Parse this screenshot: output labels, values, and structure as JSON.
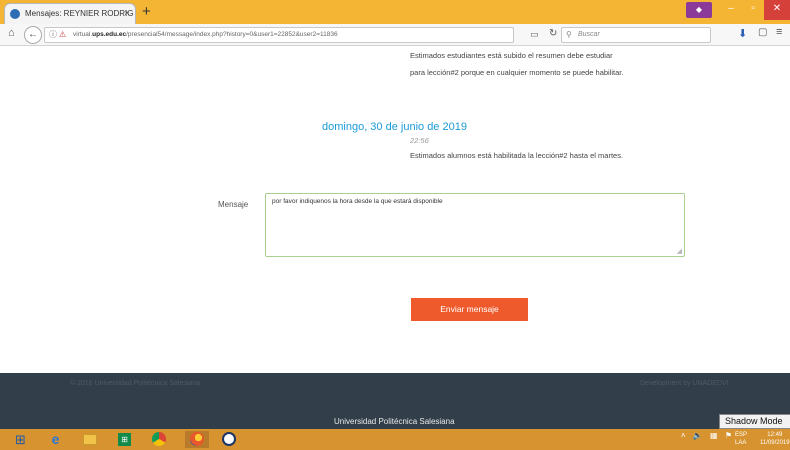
{
  "browser": {
    "tab_title": "Mensajes: REYNIER RODRIG",
    "tab_close": "×",
    "new_tab": "+",
    "url_prefix": "virtual.",
    "url_domain": "ups.edu.ec",
    "url_path": "/presencial54/message/index.php?history=0&user1=22852&user2=11836",
    "search_placeholder": "Buscar"
  },
  "messages": [
    {
      "text": "Estimados estudiantes está subido el resumen debe estudiar"
    },
    {
      "text": "para lección#2 porque en cualquier momento se puede habilitar."
    }
  ],
  "message_group": {
    "date": "domingo, 30 de junio de 2019",
    "time": "22:56",
    "text": "Estimados alumnos está habilitada la lección#2 hasta el martes."
  },
  "form": {
    "label": "Mensaje",
    "value": "por favor indiquenos la hora desde la que estará disponible",
    "send_label": "Enviar mensaje"
  },
  "footer": {
    "copyright": "© 2016 Universidad Politécnica Salesiana",
    "developed_by": "Development by UNADEDVI",
    "university": "Universidad Politécnica Salesiana"
  },
  "overlay": {
    "shadow_mode": "Shadow Mode"
  },
  "taskbar": {
    "store_glyph": "⊞",
    "language_top": "ESP",
    "language_bottom": "LAA",
    "time": "12:49",
    "date": "11/09/2019"
  },
  "colors": {
    "accent": "#ee5a2b",
    "date_blue": "#1a9bd7",
    "footer_bg": "#323f4a",
    "taskbar": "#d6932f",
    "titlebar": "#f3b533"
  }
}
